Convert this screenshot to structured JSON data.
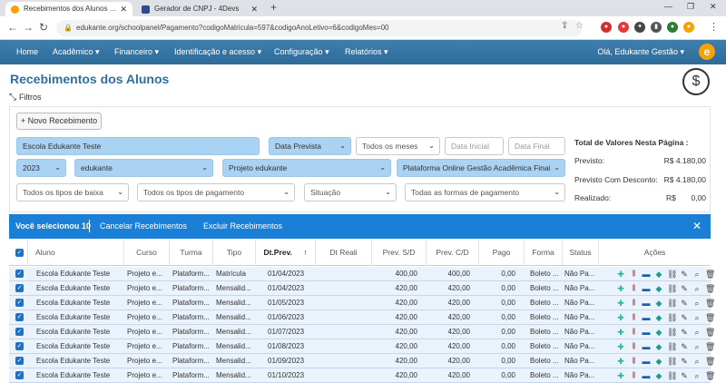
{
  "browser": {
    "tabs": [
      {
        "title": "Recebimentos dos Alunos ..."
      },
      {
        "title": "Gerador de CNPJ - 4Devs"
      }
    ],
    "url": "edukante.org/schoolpanel/Pagamento?codigoMatricula=597&codigoAnoLetivo=6&codigoMes=00"
  },
  "nav": {
    "items": [
      "Home",
      "Acadêmico",
      "Financeiro",
      "Identificação e acesso",
      "Configuração",
      "Relatórios"
    ],
    "user": "Olá, Edukante Gestão"
  },
  "page": {
    "title": "Recebimentos dos Alunos",
    "filters_label": "Filtros",
    "new_button": "+ Novo Recebimento"
  },
  "filters": {
    "aluno": "Escola Edukante Teste",
    "data_tipo": "Data Prevista",
    "meses": "Todos os meses",
    "data_inicial": "Data Inicial",
    "data_final": "Data Final",
    "ano": "2023",
    "escola": "edukante",
    "projeto": "Projeto edukante",
    "plataforma": "Plataforma Online Gestão Acadêmica Finai",
    "tipos_baixa": "Todos os tipos de baixa",
    "tipos_pagamento": "Todos os tipos de pagamento",
    "situacao": "Situação",
    "formas_pagamento": "Todas as formas de pagamento"
  },
  "totals": {
    "title": "Total de Valores Nesta Página :",
    "previsto_label": "Previsto:",
    "previsto_value": "R$ 4.180,00",
    "desconto_label": "Previsto Com Desconto:",
    "desconto_value": "R$ 4.180,00",
    "realizado_label": "Realizado:",
    "realizado_value": "R$       0,00"
  },
  "selection": {
    "text": "Você selecionou 10",
    "cancel": "Cancelar Recebimentos",
    "delete": "Excluir Recebimentos"
  },
  "table": {
    "headers": [
      "Aluno",
      "Curso",
      "Turma",
      "Tipo",
      "Dt.Prev.",
      "Dt Reali",
      "Prev. S/D",
      "Prev. C/D",
      "Pago",
      "Forma",
      "Status",
      "Ações"
    ],
    "rows": [
      [
        "Escola Edukante Teste",
        "Projeto e...",
        "Plataform...",
        "Matrícula",
        "01/04/2023",
        "",
        "400,00",
        "400,00",
        "0,00",
        "Boleto ...",
        "Não Pa..."
      ],
      [
        "Escola Edukante Teste",
        "Projeto e...",
        "Plataform...",
        "Mensalid...",
        "01/04/2023",
        "",
        "420,00",
        "420,00",
        "0,00",
        "Boleto ...",
        "Não Pa..."
      ],
      [
        "Escola Edukante Teste",
        "Projeto e...",
        "Plataform...",
        "Mensalid...",
        "01/05/2023",
        "",
        "420,00",
        "420,00",
        "0,00",
        "Boleto ...",
        "Não Pa..."
      ],
      [
        "Escola Edukante Teste",
        "Projeto e...",
        "Plataform...",
        "Mensalid...",
        "01/06/2023",
        "",
        "420,00",
        "420,00",
        "0,00",
        "Boleto ...",
        "Não Pa..."
      ],
      [
        "Escola Edukante Teste",
        "Projeto e...",
        "Plataform...",
        "Mensalid...",
        "01/07/2023",
        "",
        "420,00",
        "420,00",
        "0,00",
        "Boleto ...",
        "Não Pa..."
      ],
      [
        "Escola Edukante Teste",
        "Projeto e...",
        "Plataform...",
        "Mensalid...",
        "01/08/2023",
        "",
        "420,00",
        "420,00",
        "0,00",
        "Boleto ...",
        "Não Pa..."
      ],
      [
        "Escola Edukante Teste",
        "Projeto e...",
        "Plataform...",
        "Mensalid...",
        "01/09/2023",
        "",
        "420,00",
        "420,00",
        "0,00",
        "Boleto ...",
        "Não Pa..."
      ],
      [
        "Escola Edukante Teste",
        "Projeto e...",
        "Plataform...",
        "Mensalid...",
        "01/10/2023",
        "",
        "420,00",
        "420,00",
        "0,00",
        "Boleto ...",
        "Não Pa..."
      ]
    ]
  }
}
